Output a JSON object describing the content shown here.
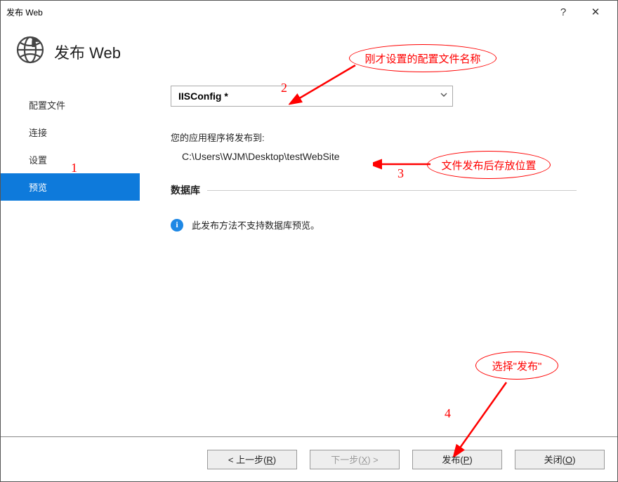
{
  "titlebar": {
    "title": "发布 Web",
    "help": "?",
    "close": "✕"
  },
  "header": {
    "title": "发布 Web"
  },
  "sidebar": {
    "items": [
      {
        "label": "配置文件"
      },
      {
        "label": "连接"
      },
      {
        "label": "设置"
      },
      {
        "label": "预览"
      }
    ]
  },
  "main": {
    "profile_value": "IISConfig *",
    "publish_label": "您的应用程序将发布到:",
    "publish_path": "C:\\Users\\WJM\\Desktop\\testWebSite",
    "db_section": "数据库",
    "db_info": "此发布方法不支持数据库预览。"
  },
  "footer": {
    "prev_a": "< 上一步(",
    "prev_u": "R",
    "prev_b": ")",
    "next_a": "下一步(",
    "next_u": "X",
    "next_b": ") >",
    "pub_a": "发布(",
    "pub_u": "P",
    "pub_b": ")",
    "close_a": "关闭(",
    "close_u": "O",
    "close_b": ")"
  },
  "annotations": {
    "n1": "1",
    "n2": "2",
    "n3": "3",
    "n4": "4",
    "b1": "刚才设置的配置文件名称",
    "b2": "文件发布后存放位置",
    "b3": "选择\"发布\""
  }
}
